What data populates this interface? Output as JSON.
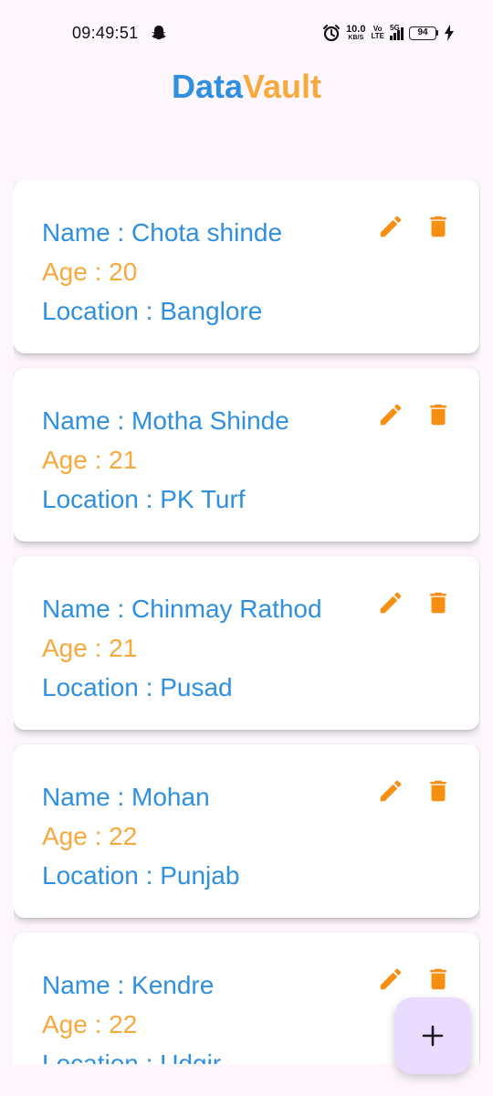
{
  "status_bar": {
    "time": "09:49:51",
    "net_speed_value": "10.0",
    "net_speed_unit": "KB/S",
    "volte_top": "Vo",
    "volte_bottom": "LTE",
    "signal_label": "5G",
    "battery_level": "94",
    "icons": [
      "snapchat-ghost-icon",
      "alarm-icon",
      "signal-icon",
      "battery-icon",
      "charging-bolt-icon"
    ]
  },
  "app": {
    "title_part1": "DataVault",
    "title_part1_a": "Data",
    "title_part1_b": "Vault",
    "colors": {
      "primary_blue": "#2f8fe0",
      "accent_orange": "#f6a93c",
      "icon_orange": "#f78f14",
      "fab_bg": "#eadcff"
    }
  },
  "records": [
    {
      "name": "Name : Chota shinde",
      "age": "Age : 20",
      "location": "Location : Banglore"
    },
    {
      "name": "Name : Motha Shinde",
      "age": "Age : 21",
      "location": "Location : PK Turf"
    },
    {
      "name": "Name : Chinmay Rathod",
      "age": "Age : 21",
      "location": "Location : Pusad"
    },
    {
      "name": "Name : Mohan",
      "age": "Age : 22",
      "location": "Location : Punjab"
    },
    {
      "name": "Name : Kendre",
      "age": "Age : 22",
      "location": "Location : Udgir"
    }
  ],
  "actions": {
    "edit_icon": "pencil-icon",
    "delete_icon": "trash-icon",
    "fab_icon": "plus-icon"
  }
}
